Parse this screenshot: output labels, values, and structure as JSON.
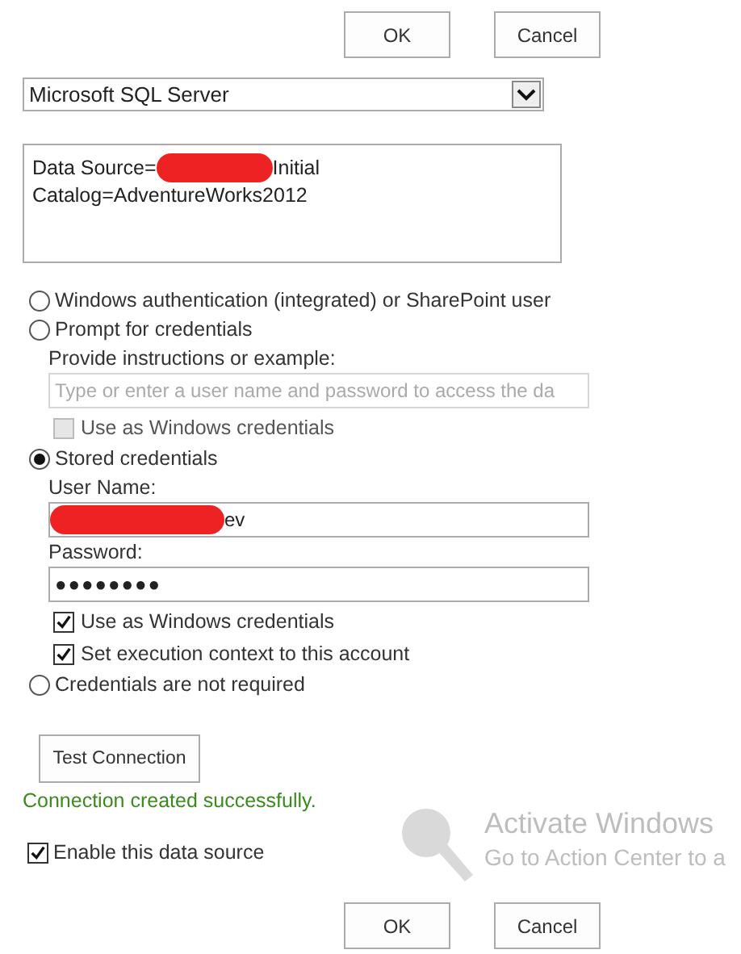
{
  "top_buttons": [
    "OK",
    "Cancel"
  ],
  "data_source_type": {
    "value": "Microsoft SQL Server"
  },
  "connection_string": {
    "before_redaction": "Data Source=",
    "after_redaction": "Initial",
    "second_line": "Catalog=AdventureWorks2012"
  },
  "auth_options": [
    {
      "kind": "plain",
      "label": "Windows authentication (integrated) or SharePoint user",
      "selected": false
    },
    {
      "kind": "prompt",
      "label": "Prompt for credentials",
      "selected": false,
      "instructions_label": "Provide instructions or example:",
      "instructions_placeholder": "Type or enter a user name and password to access the da",
      "checkboxes": [
        {
          "label": "Use as Windows credentials",
          "checked": false,
          "disabled": true
        }
      ]
    },
    {
      "kind": "stored",
      "label": "Stored credentials",
      "selected": true,
      "user_name_label": "User Name:",
      "user_name_visible": "ev",
      "password_label": "Password:",
      "password": "●●●●●●●●",
      "checkboxes": [
        {
          "label": "Use as Windows credentials",
          "checked": true,
          "disabled": false
        },
        {
          "label": "Set execution context to this account",
          "checked": true,
          "disabled": false
        }
      ]
    },
    {
      "kind": "plain",
      "label": "Credentials are not required",
      "selected": false
    }
  ],
  "test_button": "Test Connection",
  "status_message": "Connection created successfully.",
  "enable_checkbox": {
    "label": "Enable this data source",
    "checked": true
  },
  "activation_notice": {
    "title": "Activate Windows",
    "subtitle": "Go to Action Center to a"
  },
  "bottom_buttons": [
    "OK",
    "Cancel"
  ]
}
